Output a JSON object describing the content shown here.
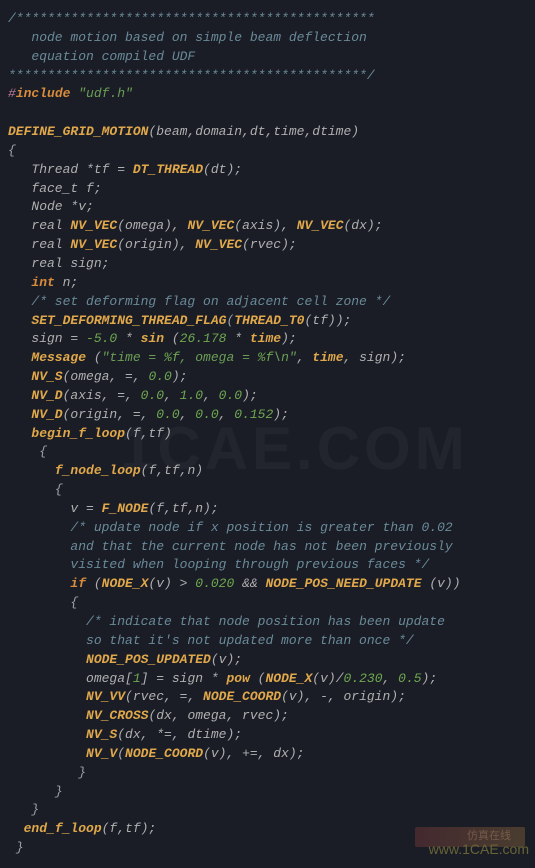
{
  "watermarks": {
    "background": "1CAE.COM",
    "url": "www.1CAE.com",
    "corner": "仿真在线"
  },
  "comment": {
    "border1": "/**********************************************",
    "line1": "   node motion based on simple beam deflection",
    "line2": "   equation compiled UDF",
    "border2": "**********************************************/"
  },
  "include": {
    "hash": "#",
    "kw": "include",
    "file": "\"udf.h\""
  },
  "defgrid": {
    "name": "DEFINE_GRID_MOTION",
    "args": "(beam,domain,dt,time,dtime)"
  },
  "decl": {
    "thread": "Thread *tf = ",
    "dt_thread": "DT_THREAD",
    "dt_arg": "(dt);",
    "facet": "face_t f;",
    "node": "Node *v;",
    "real1_a": "real ",
    "nvvec": "NV_VEC",
    "omega": "(omega), ",
    "axis": "(axis), ",
    "dx": "(dx);",
    "origin": "(origin), ",
    "rvec": "(rvec);",
    "sign": "real sign;",
    "intkw": "int",
    "n": " n;"
  },
  "cmt_deform": "/* set deforming flag on adjacent cell zone */",
  "setdef": {
    "name": "SET_DEFORMING_THREAD_FLAG",
    "t0": "THREAD_T0",
    "arg": "(tf));"
  },
  "signexpr": {
    "lhs": "sign = ",
    "neg5": "-5.0",
    "mul": " * ",
    "sin": "sin",
    "open": " (",
    "val": "26.178",
    "mul2": " * ",
    "time": "time",
    "close": ");"
  },
  "msg": {
    "name": "Message",
    "open": " (",
    "s1": "\"time = ",
    "fmt1": "%f",
    "s2": ", omega = ",
    "fmt2": "%f",
    "s3": "\\n\"",
    "comma": ", ",
    "time": "time",
    "sign": ", sign);"
  },
  "nvs": {
    "name": "NV_S",
    "args_a": "(omega, =, ",
    "zero": "0.0",
    "close": ");"
  },
  "nvd_axis": {
    "name": "NV_D",
    "a": "(axis, =, ",
    "v0": "0.0",
    "c": ", ",
    "v1": "1.0",
    "v2": "0.0",
    "close": ");"
  },
  "nvd_origin": {
    "name": "NV_D",
    "a": "(origin, =, ",
    "v0": "0.0",
    "v1": "0.0",
    "v2": "0.152",
    "close": ");"
  },
  "beginf": {
    "name": "begin_f_loop",
    "args": "(f,tf)"
  },
  "fnode": {
    "name": "f_node_loop",
    "args": "(f,tf,n)"
  },
  "fnode_assign": {
    "lhs": "v = ",
    "fn": "F_NODE",
    "args": "(f,tf,n);"
  },
  "cmt_update1": "/* update node if x position is greater than 0.02",
  "cmt_update2": "and that the current node has not been previously",
  "cmt_update3": "visited when looping through previous faces */",
  "ifstmt": {
    "kw": "if",
    "open": " (",
    "nodex": "NODE_X",
    "arg": "(v) > ",
    "val": "0.020",
    "and": " && ",
    "need": "NODE_POS_NEED_UPDATE",
    "arg2": " (v))"
  },
  "cmt_ind1": "/* indicate that node position has been update",
  "cmt_ind2": "so that it's not updated more than once */",
  "posupd": {
    "name": "NODE_POS_UPDATED",
    "args": "(v);"
  },
  "omegaline": {
    "lhs": "omega[",
    "idx": "1",
    "rhs": "] = sign * ",
    "pow": "pow",
    "open": " (",
    "nodex": "NODE_X",
    "arg": "(v)/",
    "v1": "0.230",
    "comma": ", ",
    "v2": "0.5",
    "close": ");"
  },
  "nvvv": {
    "name": "NV_VV",
    "a": "(rvec, =, ",
    "nc": "NODE_COORD",
    "b": "(v), -, origin);"
  },
  "nvcross": {
    "name": "NV_CROSS",
    "args": "(dx, omega, rvec);"
  },
  "nvs2": {
    "name": "NV_S",
    "args": "(dx, *=, dtime);"
  },
  "nvv": {
    "name": "NV_V",
    "open": "(",
    "nc": "NODE_COORD",
    "args": "(v), +=, dx);"
  },
  "endf": {
    "name": "end_f_loop",
    "args": "(f,tf);"
  },
  "braces": {
    "o": "{",
    "c": "}"
  }
}
